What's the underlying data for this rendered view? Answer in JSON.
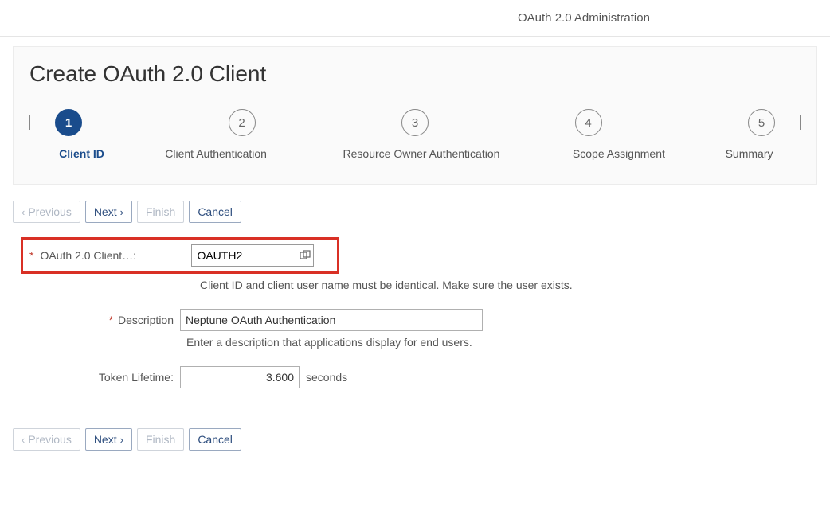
{
  "breadcrumb": {
    "title": "OAuth 2.0 Administration"
  },
  "page": {
    "title": "Create OAuth 2.0 Client"
  },
  "wizard": {
    "steps": [
      {
        "num": "1",
        "label": "Client ID",
        "active": true
      },
      {
        "num": "2",
        "label": "Client Authentication",
        "active": false
      },
      {
        "num": "3",
        "label": "Resource Owner Authentication",
        "active": false
      },
      {
        "num": "4",
        "label": "Scope Assignment",
        "active": false
      },
      {
        "num": "5",
        "label": "Summary",
        "active": false
      }
    ]
  },
  "buttons": {
    "previous": "Previous",
    "next": "Next",
    "finish": "Finish",
    "cancel": "Cancel"
  },
  "form": {
    "client_id": {
      "label": "OAuth 2.0 Client…:",
      "value": "OAUTH2",
      "hint": "Client ID and client user name must be identical. Make sure the user exists."
    },
    "description": {
      "label": "Description",
      "value": "Neptune OAuth Authentication",
      "hint": "Enter a description that applications display for end users."
    },
    "token_lifetime": {
      "label": "Token Lifetime:",
      "value": "3.600",
      "unit": "seconds"
    }
  }
}
